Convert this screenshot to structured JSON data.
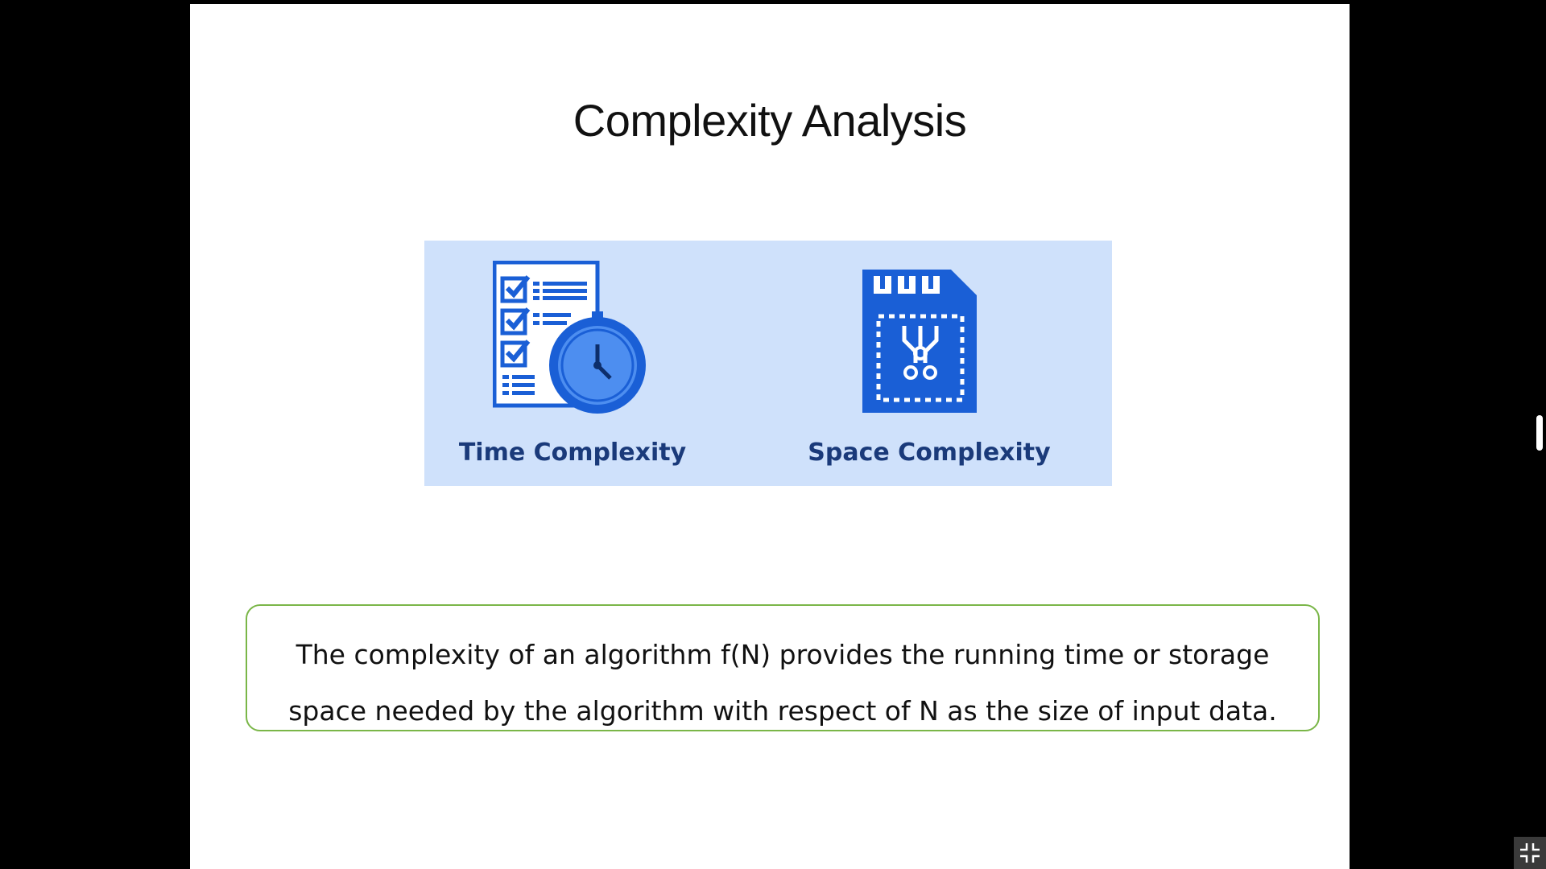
{
  "slide": {
    "title": "Complexity Analysis",
    "illustration": {
      "time_label": "Time Complexity",
      "space_label": "Space Complexity",
      "time_icon": "stopwatch-checklist-icon",
      "space_icon": "memory-card-icon"
    },
    "definition": "The complexity of an algorithm f(N) provides the running time or storage space needed by the algorithm with respect of N as the size of input data."
  },
  "controls": {
    "exit_fullscreen_icon": "exit-fullscreen-icon"
  },
  "colors": {
    "illustration_background": "#cfe1fb",
    "icon_blue": "#1a5fd6",
    "icon_light": "#4d8ef0",
    "label_navy": "#1a3a7a",
    "box_border": "#7ab648"
  }
}
